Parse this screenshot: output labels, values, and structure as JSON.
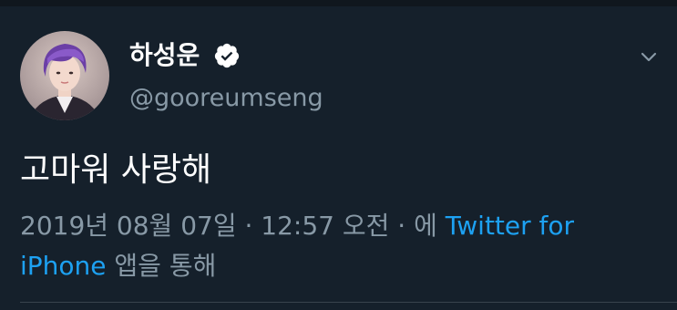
{
  "author": {
    "display_name": "하성운",
    "handle": "@gooreumseng",
    "verified": true,
    "avatar": "profile-photo"
  },
  "tweet": {
    "text": "고마워 사랑해",
    "timestamp": "2019년 08월 07일 · 12:57 오전 · ",
    "via_prefix": "에 ",
    "source": "Twitter for iPhone",
    "via_suffix": " 앱을 통해"
  },
  "icons": {
    "verified": "verified-badge-icon",
    "menu": "chevron-down-icon"
  },
  "colors": {
    "background": "#15202b",
    "secondary_text": "#8899a6",
    "link": "#1da1f2",
    "primary_text": "#ffffff"
  }
}
